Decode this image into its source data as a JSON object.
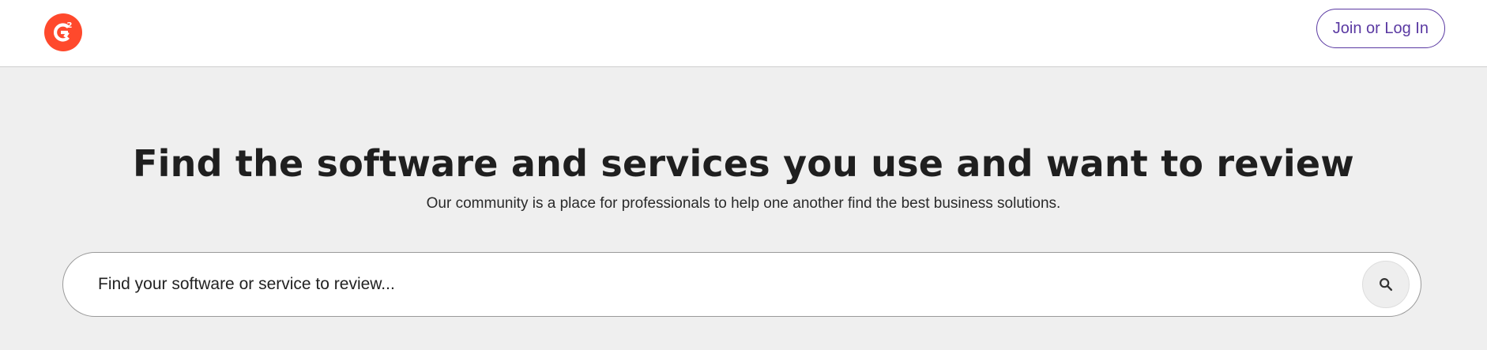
{
  "header": {
    "logo_icon": "g2-logo-icon",
    "brand_color": "#ff492c",
    "login_label": "Join or Log In",
    "login_color": "#5a39a2"
  },
  "hero": {
    "title": "Find the software and services you use and want to review",
    "subtitle": "Our community is a place for professionals to help one another find the best business solutions."
  },
  "search": {
    "placeholder": "Find your software or service to review...",
    "value": "",
    "button_icon": "search-icon"
  }
}
